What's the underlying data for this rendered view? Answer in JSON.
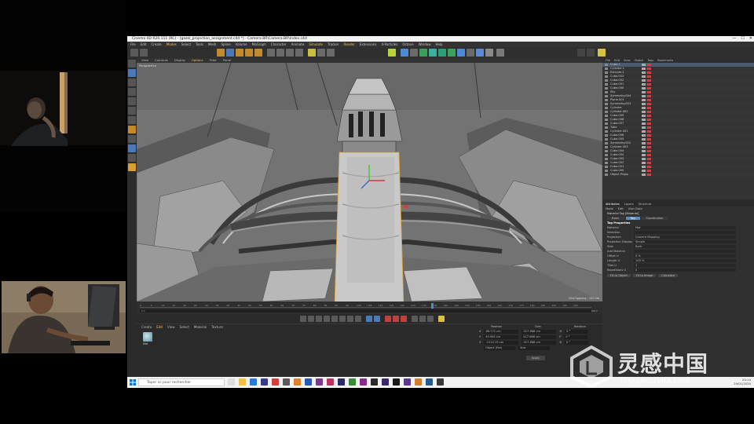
{
  "window": {
    "title": "Cinema 4D R20.111 (RC) - [gazel_projection_assignment.c4d *] - Camera.BR\\Camera.BR\\Index.c4d",
    "controls": [
      "—",
      "☐",
      "✕"
    ]
  },
  "menu": [
    "File",
    "Edit",
    "Create",
    "Modes",
    "Select",
    "Tools",
    "Mesh",
    "Spline",
    "Volume",
    "MoGraph",
    "Character",
    "Animate",
    "Simulate",
    "Tracker",
    "Render",
    "Extensions",
    "X-Particles",
    "Octane",
    "Window",
    "Help"
  ],
  "menu_highlight": [
    "Modes",
    "Simulate",
    "Render"
  ],
  "viewport": {
    "menu": [
      "View",
      "Cameras",
      "Display",
      "Options",
      "Filter",
      "Panel"
    ],
    "label": "Perspective",
    "grid_spacing": "Grid Spacing : 100 cm"
  },
  "timeline": {
    "ticks": [
      "0",
      "5",
      "10",
      "15",
      "20",
      "25",
      "30",
      "35",
      "40",
      "45",
      "50",
      "55",
      "60",
      "65",
      "70",
      "75",
      "80",
      "85",
      "90",
      "95",
      "100",
      "105",
      "110",
      "115",
      "120",
      "125",
      "130",
      "135",
      "140",
      "145",
      "150",
      "155",
      "160",
      "165",
      "170",
      "175",
      "180",
      "185",
      "190",
      "195",
      "200"
    ],
    "start": "0 F",
    "end": "300 F",
    "current": "0 F"
  },
  "material": {
    "menu": [
      "Create",
      "Edit",
      "View",
      "Select",
      "Material",
      "Texture"
    ],
    "name": "Mat"
  },
  "coordinates": {
    "headers": [
      "Position",
      "Size",
      "Rotation"
    ],
    "rows": [
      {
        "axis": "X",
        "pos": "86.771 cm",
        "size": "417.668 cm",
        "rot_axis": "H",
        "rot": "0 °"
      },
      {
        "axis": "Y",
        "pos": "49.962 cm",
        "size": "417.668 cm",
        "rot_axis": "P",
        "rot": "0 °"
      },
      {
        "axis": "Z",
        "pos": "-1210.15 cm",
        "size": "417.668 cm",
        "rot_axis": "B",
        "rot": "0 °"
      }
    ],
    "mode": "Object (Rel)",
    "size_mode": "Size",
    "apply": "Apply"
  },
  "objects": {
    "menu": [
      "File",
      "Edit",
      "View",
      "Object",
      "Tags",
      "Bookmarks"
    ],
    "items": [
      "Cube.1",
      "Cylinder.1",
      "Extrude.2",
      "Cube.003",
      "Cube.002",
      "Cube.001",
      "Cube.000",
      "Sky",
      "Symmetry.004",
      "Plane.001",
      "Symmetry.003",
      "Cylinder",
      "Cylinder.002",
      "Cube.009",
      "Cube.008",
      "Cube.007",
      "Tube",
      "Cylinder.001",
      "Cube.006",
      "Cube.005",
      "Symmetry.002",
      "Cylinder.003",
      "Cube.004",
      "Cube.004",
      "Cube.003",
      "Cube.002",
      "Cube.001",
      "Cube.000",
      "Object Props"
    ]
  },
  "attributes": {
    "tabs": [
      "Attributes",
      "Layers",
      "Structure"
    ],
    "menu": [
      "Mode",
      "Edit",
      "User Data"
    ],
    "header": "Material Tag [Material]",
    "subtabs": [
      "Basic",
      "Tag",
      "Coordinates"
    ],
    "section": "Tag Properties",
    "rows": [
      "Material",
      "Selection",
      "Projection",
      "Projection Display",
      "Side",
      "Add Material",
      "Offset U",
      "Length U",
      "Tiles U",
      "Repetitions U"
    ],
    "values": [
      "Mat",
      "",
      "Camera Mapping",
      "Simple",
      "Both",
      "",
      "0 %",
      "100 %",
      "1",
      "0"
    ],
    "fit_buttons": [
      "Fit to Object",
      "Fit to Image",
      "Calculate"
    ]
  },
  "taskbar": {
    "search_placeholder": "Taper ici pour rechercher",
    "time": "20:14",
    "date": "29/01/2020"
  },
  "watermark": {
    "title": "灵感中国",
    "url": "lingganchina.com"
  },
  "colors": {
    "app_bg": "#2b2b2b",
    "viewport_bg": "#6e6e6e",
    "accent": "#f0c25c",
    "selected": "#5b8cc0"
  }
}
